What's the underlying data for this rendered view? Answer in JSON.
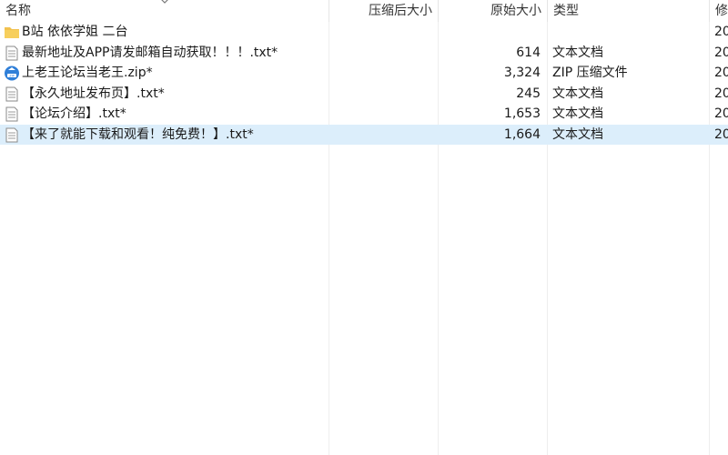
{
  "columns": {
    "name": "名称",
    "compressed": "压缩后大小",
    "original": "原始大小",
    "type": "类型",
    "modified": "修"
  },
  "rows": [
    {
      "icon": "folder-icon",
      "name": "B站 依依学姐 二台",
      "compressed": "",
      "size": "",
      "type": "",
      "modified": "20"
    },
    {
      "icon": "text-document-icon",
      "name": "最新地址及APP请发邮箱自动获取！！！.txt*",
      "compressed": "",
      "size": "614",
      "type": "文本文档",
      "modified": "20"
    },
    {
      "icon": "zip-archive-icon",
      "name": "上老王论坛当老王.zip*",
      "compressed": "",
      "size": "3,324",
      "type": "ZIP 压缩文件",
      "modified": "20"
    },
    {
      "icon": "text-document-icon",
      "name": "【永久地址发布页】.txt*",
      "compressed": "",
      "size": "245",
      "type": "文本文档",
      "modified": "20"
    },
    {
      "icon": "text-document-icon",
      "name": "【论坛介绍】.txt*",
      "compressed": "",
      "size": "1,653",
      "type": "文本文档",
      "modified": "20"
    },
    {
      "icon": "text-document-icon",
      "name": "【来了就能下载和观看！纯免费！】.txt*",
      "compressed": "",
      "size": "1,664",
      "type": "文本文档",
      "modified": "20",
      "selected": true
    }
  ],
  "colors": {
    "selection": "#dceefb",
    "folder": "#f2c14e",
    "zip": "#2f7fd8"
  }
}
